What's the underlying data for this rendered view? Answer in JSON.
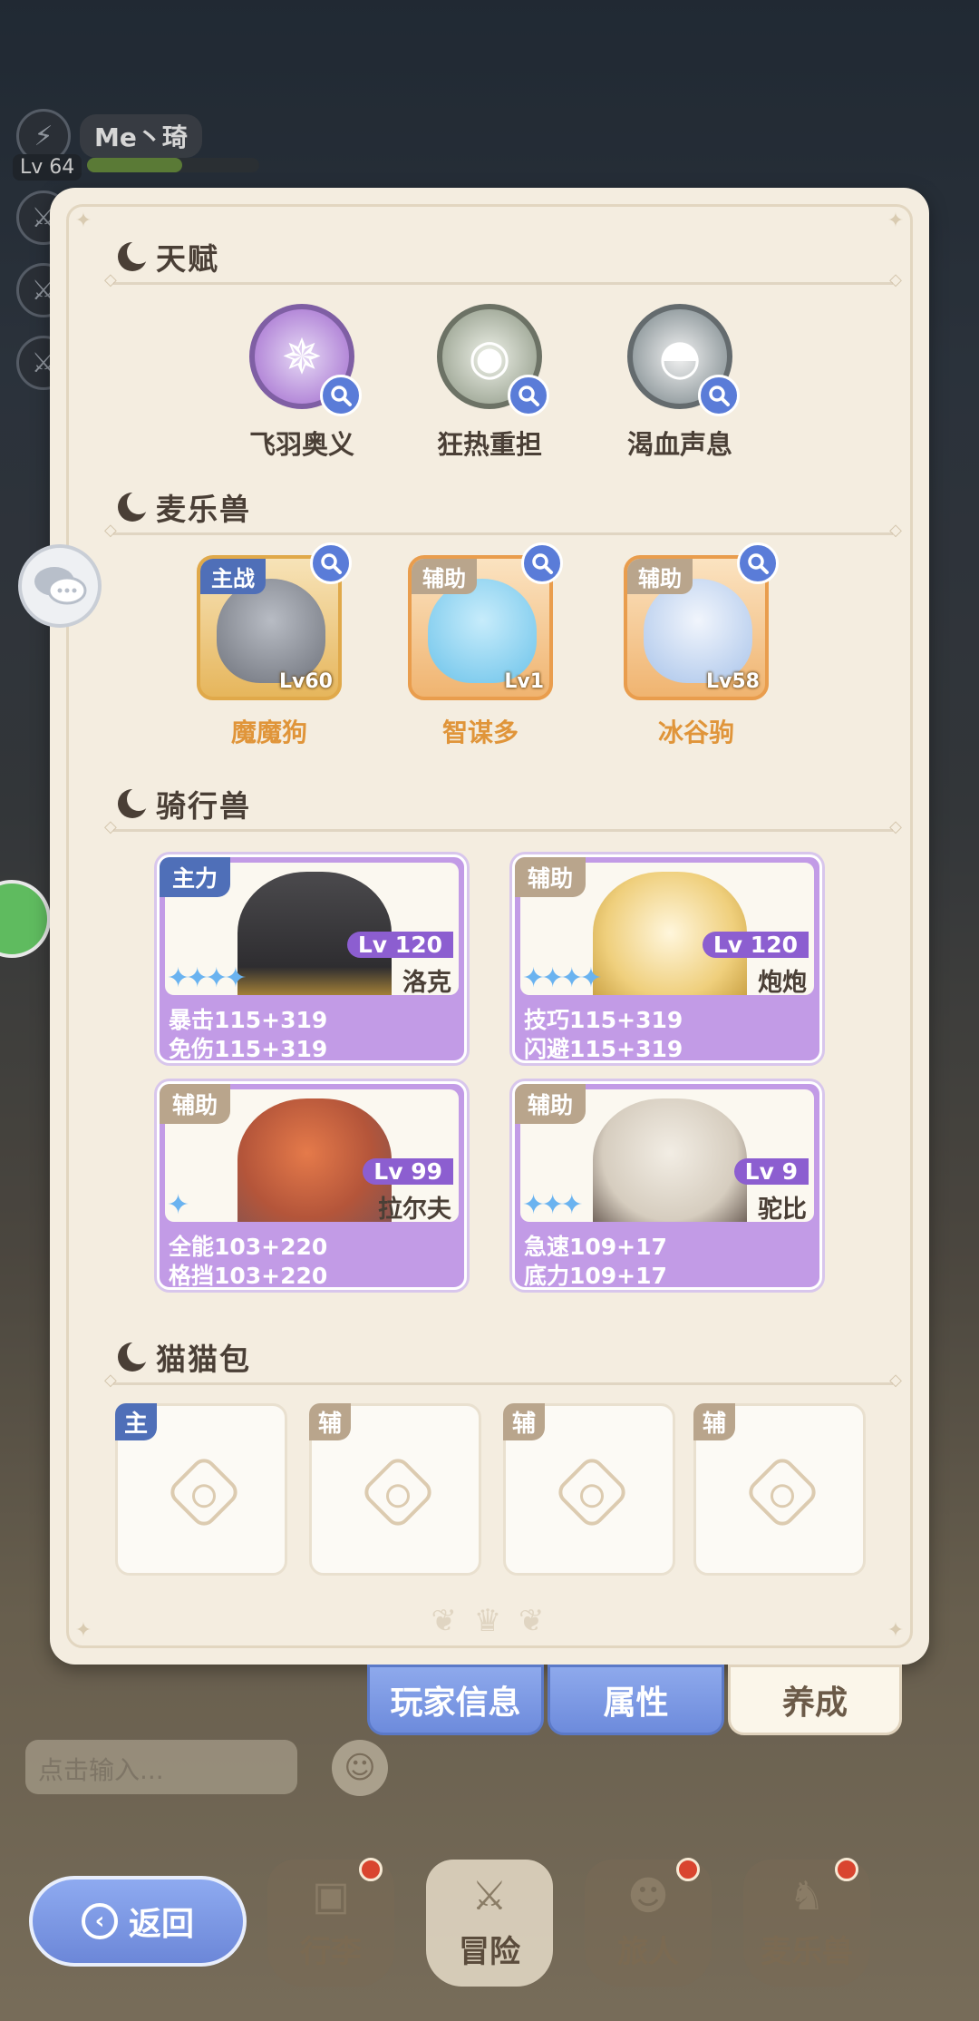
{
  "hud": {
    "player_name": "Me丶琦",
    "level": "Lv 64"
  },
  "sections": {
    "talent": "天赋",
    "pets": "麦乐兽",
    "mounts": "骑行兽",
    "bags": "猫猫包"
  },
  "talents": [
    {
      "name": "飞羽奥义",
      "icon": "shuriken-icon"
    },
    {
      "name": "狂热重担",
      "icon": "eye-shield-icon"
    },
    {
      "name": "渴血声息",
      "icon": "hooded-drop-icon"
    }
  ],
  "pets": [
    {
      "tag": "主战",
      "name": "魔魔狗",
      "level": "Lv60",
      "art_color": "#8a8e96"
    },
    {
      "tag": "辅助",
      "name": "智谋多",
      "level": "Lv1",
      "art_color": "#7fd0ef"
    },
    {
      "tag": "辅助",
      "name": "冰谷驹",
      "level": "Lv58",
      "art_color": "#c8dcf4"
    }
  ],
  "mounts": [
    {
      "tag": "主力",
      "level": "Lv 120",
      "name": "洛克",
      "stars": 4,
      "stat1": "暴击115+319",
      "stat2": "免伤115+319",
      "art_color": "#3b3a3c"
    },
    {
      "tag": "辅助",
      "level": "Lv 120",
      "name": "炮炮",
      "stars": 4,
      "stat1": "技巧115+319",
      "stat2": "闪避115+319",
      "art_color": "#f1d48a"
    },
    {
      "tag": "辅助",
      "level": "Lv 99",
      "name": "拉尔夫",
      "stars": 1,
      "stat1": "全能103+220",
      "stat2": "格挡103+220",
      "art_color": "#c9553a"
    },
    {
      "tag": "辅助",
      "level": "Lv 9",
      "name": "驼比",
      "stars": 3,
      "stat1": "急速109+17",
      "stat2": "底力109+17",
      "art_color": "#d9d0c2"
    }
  ],
  "bags": [
    {
      "tag": "主"
    },
    {
      "tag": "辅"
    },
    {
      "tag": "辅"
    },
    {
      "tag": "辅"
    }
  ],
  "tabs": {
    "player_info": "玩家信息",
    "attributes": "属性",
    "cultivate": "养成"
  },
  "chat": {
    "placeholder": "点击输入..."
  },
  "nav": {
    "bag": "行李",
    "adventure": "冒险",
    "travelers": "旅人",
    "pets": "麦乐兽"
  },
  "back_label": "返回",
  "colors": {
    "panel_bg": "#f4ede0",
    "mount_purple": "#c29be6",
    "tab_blue": "#7d98e2",
    "main_tag_blue": "#4f6fb8",
    "sub_tag_tan": "#b9a58c",
    "pet_name_orange": "#e0953a"
  }
}
